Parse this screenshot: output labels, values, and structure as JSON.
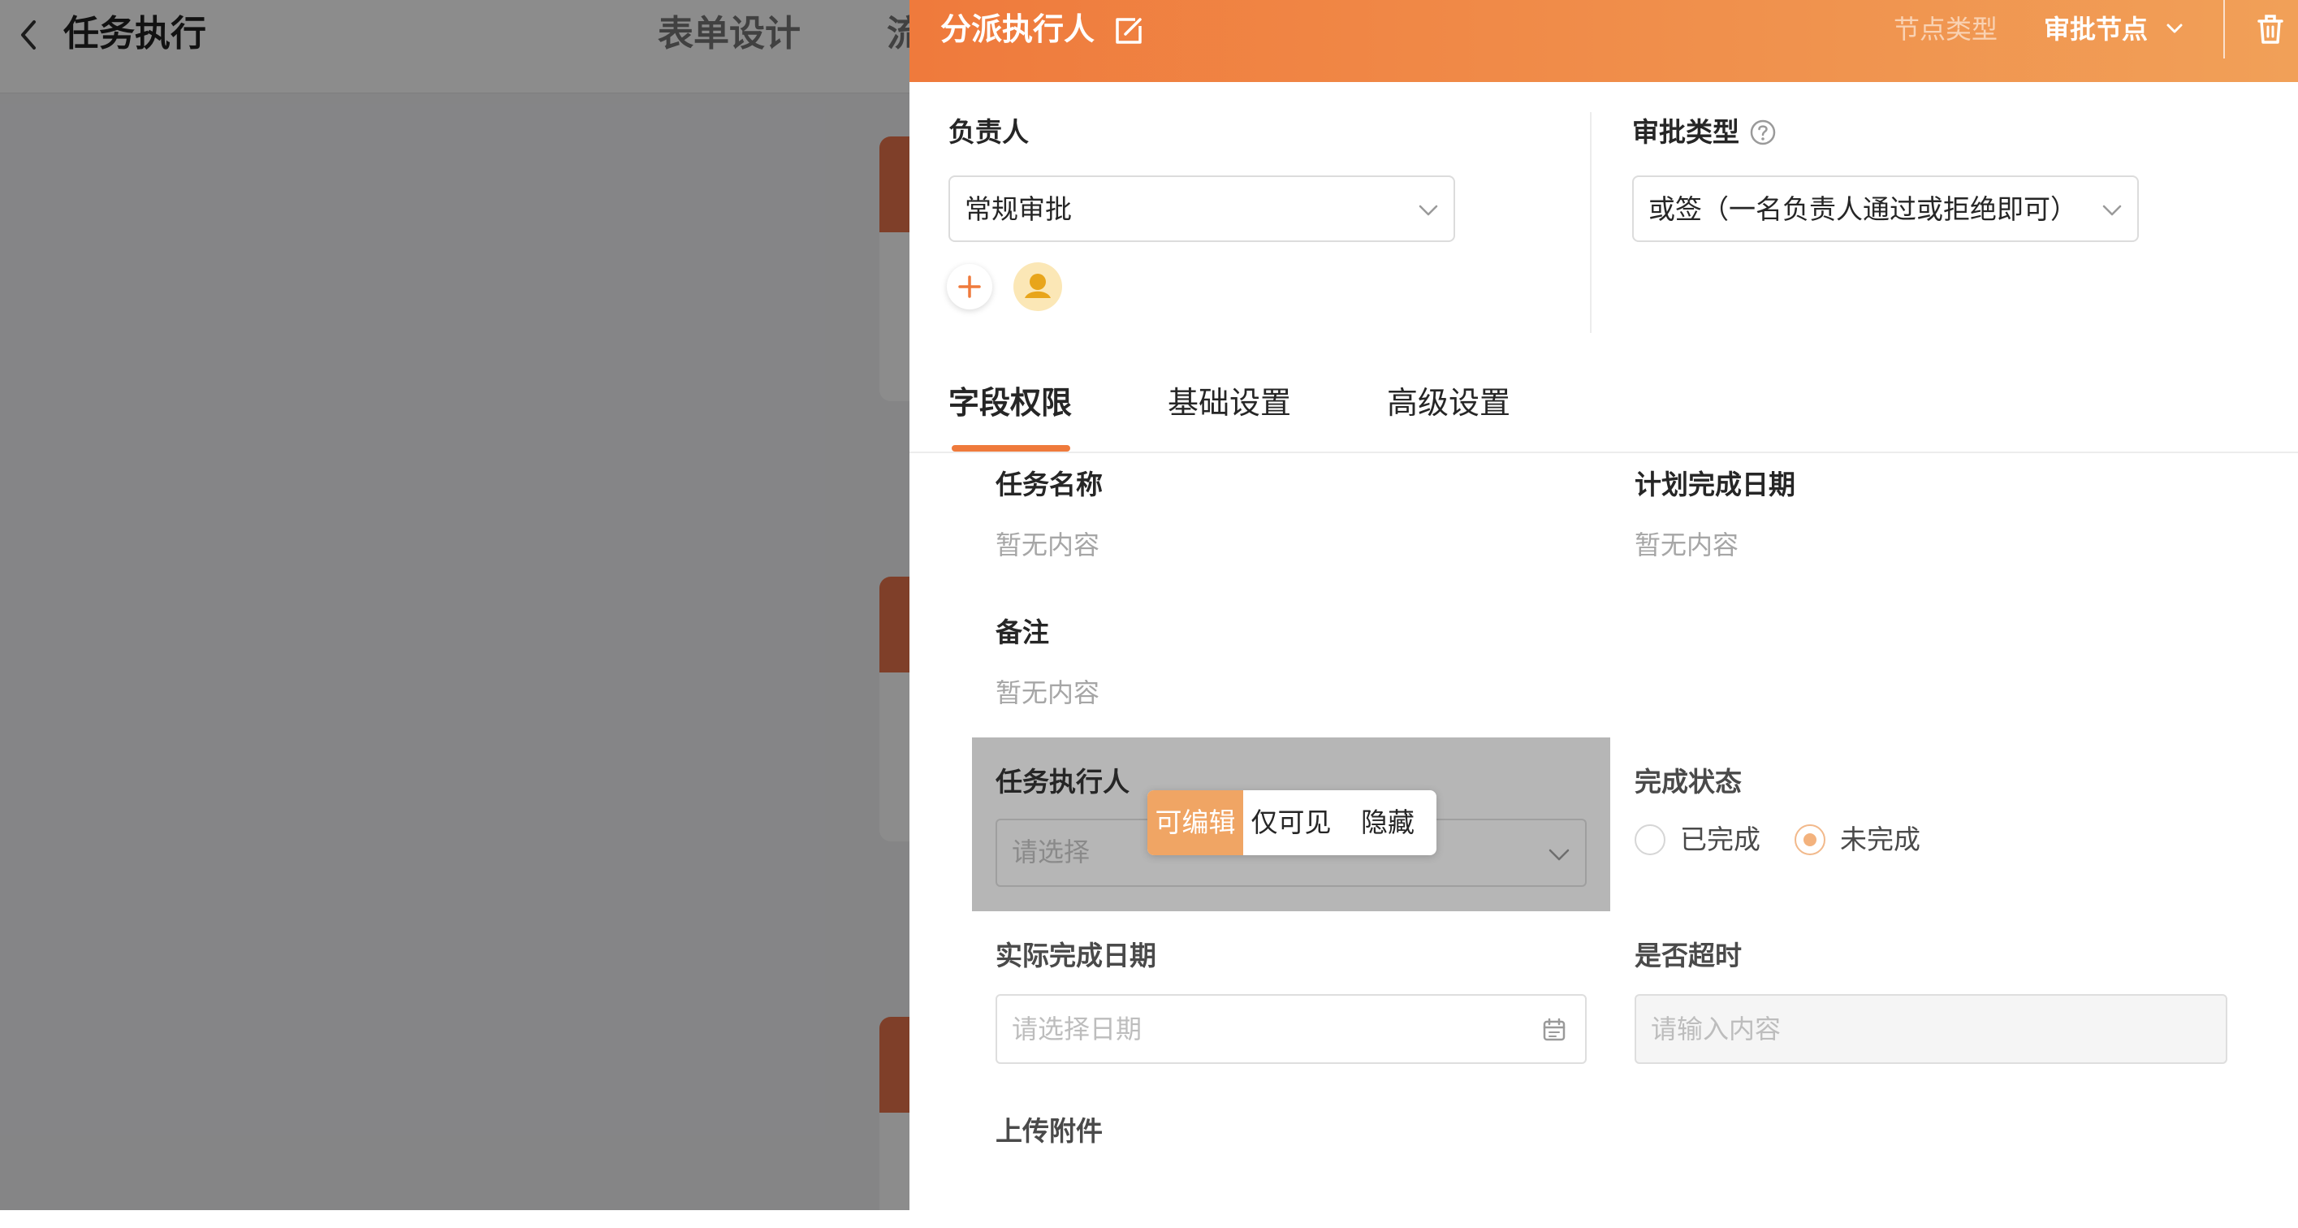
{
  "background": {
    "page_title": "任务执行",
    "tabs": [
      "表单设计",
      "流"
    ]
  },
  "drawer": {
    "title": "分派执行人",
    "node_type_label": "节点类型",
    "node_type_value": "审批节点",
    "assignee": {
      "label": "负责人",
      "value": "常规审批"
    },
    "approval_type": {
      "label": "审批类型",
      "value": "或签（一名负责人通过或拒绝即可）"
    },
    "tabs": [
      {
        "label": "字段权限",
        "active": true
      },
      {
        "label": "基础设置",
        "active": false
      },
      {
        "label": "高级设置",
        "active": false
      }
    ],
    "fields": {
      "task_name": {
        "label": "任务名称",
        "value": "暂无内容"
      },
      "plan_date": {
        "label": "计划完成日期",
        "value": "暂无内容"
      },
      "remark": {
        "label": "备注",
        "value": "暂无内容"
      },
      "executor": {
        "label": "任务执行人",
        "placeholder": "请选择"
      },
      "status": {
        "label": "完成状态",
        "options": [
          "已完成",
          "未完成"
        ],
        "selected": "未完成"
      },
      "actual_date": {
        "label": "实际完成日期",
        "placeholder": "请选择日期"
      },
      "overdue": {
        "label": "是否超时",
        "placeholder": "请输入内容"
      },
      "attachment": {
        "label": "上传附件"
      }
    },
    "permission_options": [
      {
        "label": "可编辑",
        "active": true
      },
      {
        "label": "仅可见",
        "active": false
      },
      {
        "label": "隐藏",
        "active": false
      }
    ]
  },
  "colors": {
    "accent": "#ef7a3c",
    "accent_light": "#f0a564",
    "overlay": "rgba(0,0,0,0.45)"
  },
  "icons": [
    "back-arrow-icon",
    "edit-icon",
    "chevron-down-icon",
    "trash-icon",
    "plus-icon",
    "user-avatar-icon",
    "help-circle-icon",
    "calendar-icon"
  ]
}
